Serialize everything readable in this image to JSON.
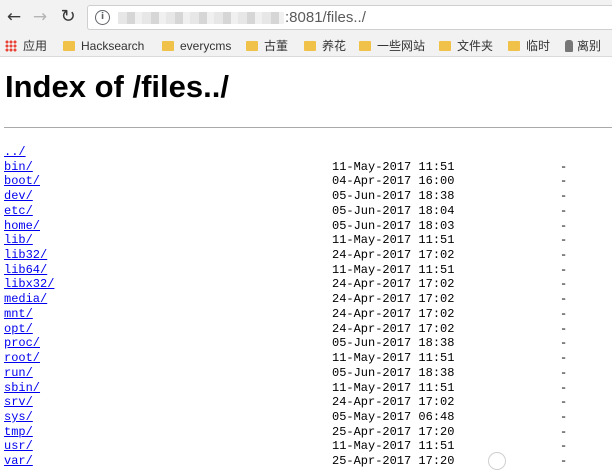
{
  "toolbar": {
    "back_icon": "arrow-left-icon",
    "forward_icon": "arrow-right-icon",
    "reload_icon": "reload-icon",
    "info_icon": "info-icon",
    "url": ":8081/files../"
  },
  "bookmarks": [
    {
      "label": "应用",
      "icon": "apps-grid-icon"
    },
    {
      "label": "Hacksearch",
      "icon": "folder-icon"
    },
    {
      "label": "everycms",
      "icon": "folder-icon"
    },
    {
      "label": "古董",
      "icon": "folder-icon"
    },
    {
      "label": "养花",
      "icon": "folder-icon"
    },
    {
      "label": "一些网站",
      "icon": "folder-icon"
    },
    {
      "label": "文件夹",
      "icon": "folder-icon"
    },
    {
      "label": "临时",
      "icon": "folder-icon"
    },
    {
      "label": "离别",
      "icon": "bookmark-icon"
    }
  ],
  "page": {
    "title": "Index of /files../"
  },
  "listing": [
    {
      "name": "../",
      "date": "",
      "size": ""
    },
    {
      "name": "bin/",
      "date": "11-May-2017 11:51",
      "size": "-"
    },
    {
      "name": "boot/",
      "date": "04-Apr-2017 16:00",
      "size": "-"
    },
    {
      "name": "dev/",
      "date": "05-Jun-2017 18:38",
      "size": "-"
    },
    {
      "name": "etc/",
      "date": "05-Jun-2017 18:04",
      "size": "-"
    },
    {
      "name": "home/",
      "date": "05-Jun-2017 18:03",
      "size": "-"
    },
    {
      "name": "lib/",
      "date": "11-May-2017 11:51",
      "size": "-"
    },
    {
      "name": "lib32/",
      "date": "24-Apr-2017 17:02",
      "size": "-"
    },
    {
      "name": "lib64/",
      "date": "11-May-2017 11:51",
      "size": "-"
    },
    {
      "name": "libx32/",
      "date": "24-Apr-2017 17:02",
      "size": "-"
    },
    {
      "name": "media/",
      "date": "24-Apr-2017 17:02",
      "size": "-"
    },
    {
      "name": "mnt/",
      "date": "24-Apr-2017 17:02",
      "size": "-"
    },
    {
      "name": "opt/",
      "date": "24-Apr-2017 17:02",
      "size": "-"
    },
    {
      "name": "proc/",
      "date": "05-Jun-2017 18:38",
      "size": "-"
    },
    {
      "name": "root/",
      "date": "11-May-2017 11:51",
      "size": "-"
    },
    {
      "name": "run/",
      "date": "05-Jun-2017 18:38",
      "size": "-"
    },
    {
      "name": "sbin/",
      "date": "11-May-2017 11:51",
      "size": "-"
    },
    {
      "name": "srv/",
      "date": "24-Apr-2017 17:02",
      "size": "-"
    },
    {
      "name": "sys/",
      "date": "05-May-2017 06:48",
      "size": "-"
    },
    {
      "name": "tmp/",
      "date": "25-Apr-2017 17:20",
      "size": "-"
    },
    {
      "name": "usr/",
      "date": "11-May-2017 11:51",
      "size": "-"
    },
    {
      "name": "var/",
      "date": "25-Apr-2017 17:20",
      "size": "-"
    }
  ]
}
